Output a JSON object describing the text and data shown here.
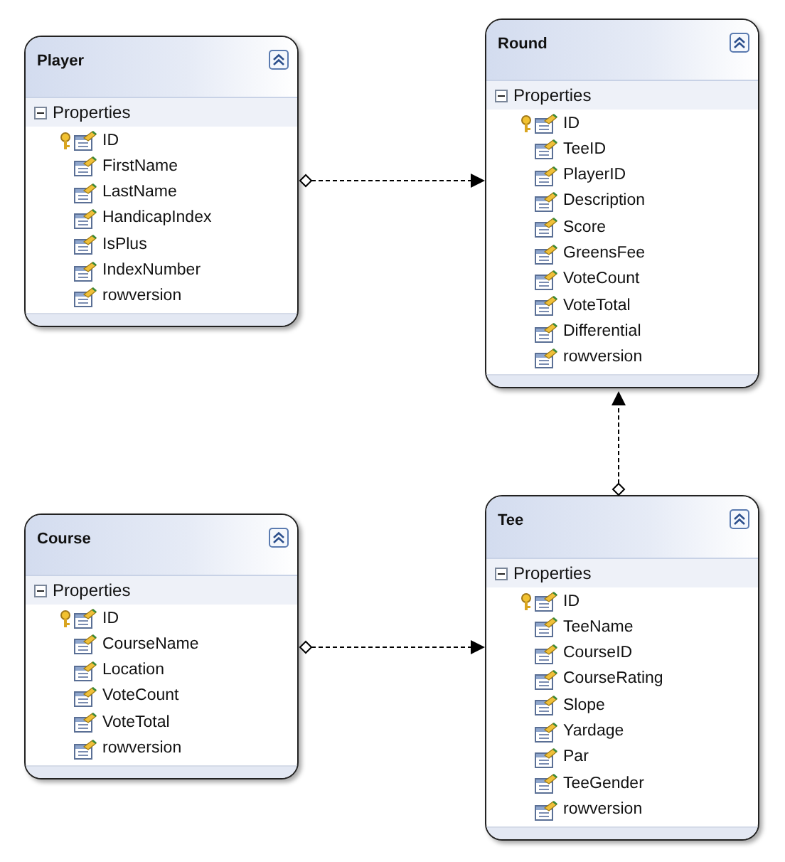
{
  "entities": [
    {
      "name": "Player",
      "section": {
        "label": "Properties",
        "expanded": true
      },
      "properties": [
        {
          "name": "ID",
          "key": true
        },
        {
          "name": "FirstName",
          "key": false
        },
        {
          "name": "LastName",
          "key": false
        },
        {
          "name": "HandicapIndex",
          "key": false
        },
        {
          "name": "IsPlus",
          "key": false
        },
        {
          "name": "IndexNumber",
          "key": false
        },
        {
          "name": "rowversion",
          "key": false
        }
      ]
    },
    {
      "name": "Round",
      "section": {
        "label": "Properties",
        "expanded": true
      },
      "properties": [
        {
          "name": "ID",
          "key": true
        },
        {
          "name": "TeeID",
          "key": false
        },
        {
          "name": "PlayerID",
          "key": false
        },
        {
          "name": "Description",
          "key": false
        },
        {
          "name": "Score",
          "key": false
        },
        {
          "name": "GreensFee",
          "key": false
        },
        {
          "name": "VoteCount",
          "key": false
        },
        {
          "name": "VoteTotal",
          "key": false
        },
        {
          "name": "Differential",
          "key": false
        },
        {
          "name": "rowversion",
          "key": false
        }
      ]
    },
    {
      "name": "Course",
      "section": {
        "label": "Properties",
        "expanded": true
      },
      "properties": [
        {
          "name": "ID",
          "key": true
        },
        {
          "name": "CourseName",
          "key": false
        },
        {
          "name": "Location",
          "key": false
        },
        {
          "name": "VoteCount",
          "key": false
        },
        {
          "name": "VoteTotal",
          "key": false
        },
        {
          "name": "rowversion",
          "key": false
        }
      ]
    },
    {
      "name": "Tee",
      "section": {
        "label": "Properties",
        "expanded": true
      },
      "properties": [
        {
          "name": "ID",
          "key": true
        },
        {
          "name": "TeeName",
          "key": false
        },
        {
          "name": "CourseID",
          "key": false
        },
        {
          "name": "CourseRating",
          "key": false
        },
        {
          "name": "Slope",
          "key": false
        },
        {
          "name": "Yardage",
          "key": false
        },
        {
          "name": "Par",
          "key": false
        },
        {
          "name": "TeeGender",
          "key": false
        },
        {
          "name": "rowversion",
          "key": false
        }
      ]
    }
  ]
}
